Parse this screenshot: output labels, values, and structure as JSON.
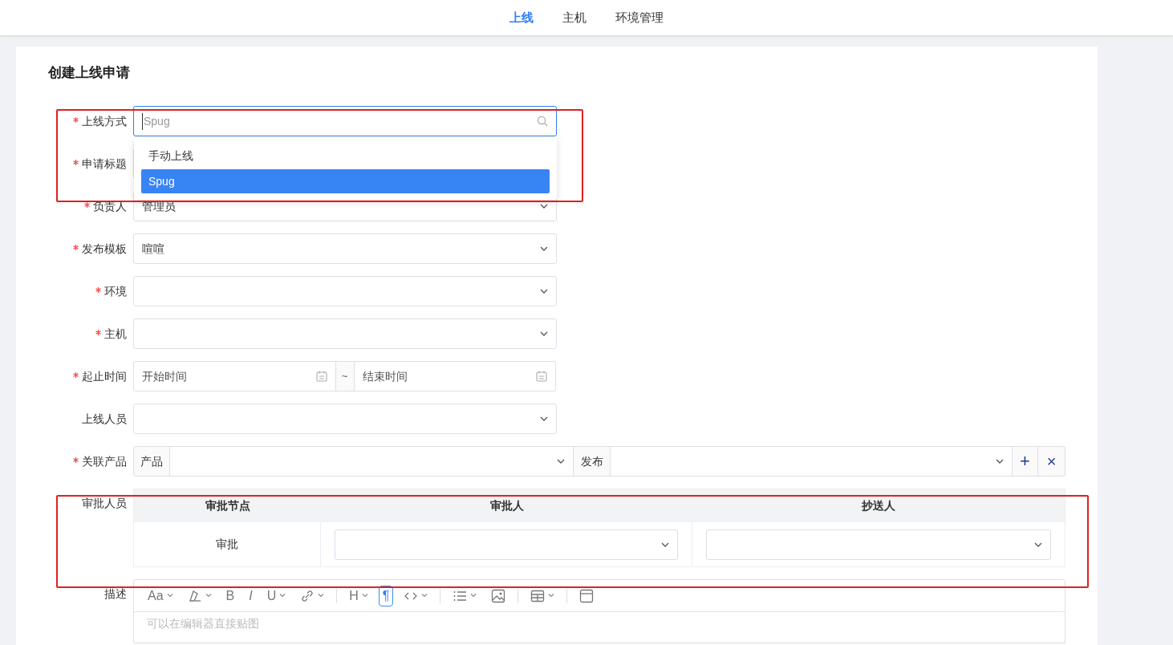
{
  "nav": {
    "tabs": [
      {
        "label": "上线",
        "selected": true
      },
      {
        "label": "主机",
        "selected": false
      },
      {
        "label": "环境管理",
        "selected": false
      }
    ]
  },
  "card": {
    "title": "创建上线申请"
  },
  "fields": [
    {
      "kind": "search",
      "label": "上线方式",
      "required": true,
      "placeholder": "Spug",
      "focused": true
    },
    {
      "kind": "select",
      "label": "申请标题",
      "required": true
    },
    {
      "kind": "select",
      "label": "负责人",
      "required": true,
      "value": "管理员"
    },
    {
      "kind": "select",
      "label": "发布模板",
      "required": true,
      "value": "喧喧"
    },
    {
      "kind": "select",
      "label": "环境",
      "required": true
    },
    {
      "kind": "select",
      "label": "主机",
      "required": true
    },
    {
      "kind": "daterange",
      "label": "起止时间",
      "required": true,
      "start_placeholder": "开始时间",
      "separator": "~",
      "end_placeholder": "结束时间"
    },
    {
      "kind": "select",
      "label": "上线人员",
      "required": false
    },
    {
      "kind": "product",
      "label": "关联产品",
      "required": true,
      "product_addon": "产品",
      "release_addon": "发布",
      "add_symbol": "+",
      "remove_symbol": "×"
    },
    {
      "kind": "approval",
      "label": "审批人员",
      "required": false,
      "columns": [
        "审批节点",
        "审批人",
        "抄送人"
      ],
      "rows": [
        {
          "node": "审批"
        }
      ]
    },
    {
      "kind": "editor",
      "label": "描述",
      "required": false,
      "placeholder": "可以在编辑器直接贴图",
      "toolbar": [
        {
          "kind": "glyph",
          "label": "Aa",
          "caret": true,
          "selected": false
        },
        {
          "kind": "brush",
          "caret": true,
          "selected": false
        },
        {
          "kind": "glyph",
          "label": "B",
          "caret": false,
          "selected": false
        },
        {
          "kind": "glyph",
          "label": "I",
          "caret": false,
          "selected": false
        },
        {
          "kind": "glyph",
          "label": "U",
          "caret": true,
          "selected": false
        },
        {
          "kind": "link",
          "caret": true,
          "selected": false
        },
        {
          "kind": "divider"
        },
        {
          "kind": "glyph",
          "label": "H",
          "caret": true,
          "selected": false
        },
        {
          "kind": "glyph",
          "label": "¶",
          "caret": false,
          "selected": true
        },
        {
          "kind": "code",
          "caret": true,
          "selected": false
        },
        {
          "kind": "divider"
        },
        {
          "kind": "list",
          "caret": true,
          "selected": false
        },
        {
          "kind": "image",
          "caret": false,
          "selected": false
        },
        {
          "kind": "divider"
        },
        {
          "kind": "table",
          "caret": true,
          "selected": false
        },
        {
          "kind": "divider"
        },
        {
          "kind": "panel",
          "caret": false,
          "selected": false
        }
      ]
    }
  ],
  "dropdown": {
    "options": [
      {
        "label": "手动上线",
        "selected": false
      },
      {
        "label": "Spug",
        "selected": true
      }
    ]
  }
}
